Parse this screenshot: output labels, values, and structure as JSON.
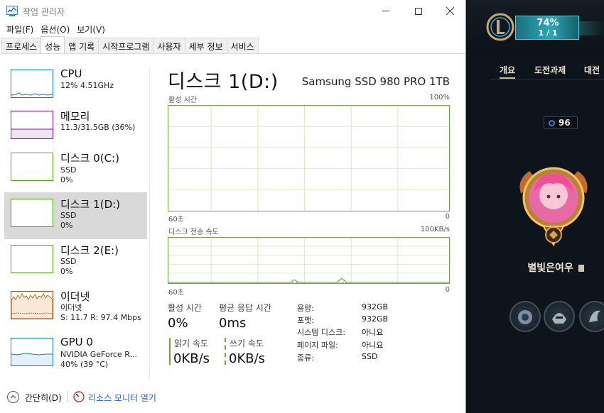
{
  "window": {
    "title": "작업 관리자",
    "controls": {
      "minimize": "—",
      "maximize": "☐",
      "close": "✕"
    }
  },
  "menu": [
    "파일(F)",
    "옵션(O)",
    "보기(V)"
  ],
  "tabs": [
    {
      "label": "프로세스",
      "active": false
    },
    {
      "label": "성능",
      "active": true
    },
    {
      "label": "앱 기록",
      "active": false
    },
    {
      "label": "시작프로그램",
      "active": false
    },
    {
      "label": "사용자",
      "active": false
    },
    {
      "label": "세부 정보",
      "active": false
    },
    {
      "label": "서비스",
      "active": false
    }
  ],
  "sidebar": {
    "items": [
      {
        "title": "CPU",
        "line1": "12% 4.51GHz",
        "line2": "",
        "color": "#117dbb",
        "selected": false
      },
      {
        "title": "메모리",
        "line1": "11.3/31.5GB (36%)",
        "line2": "",
        "color": "#8b12ae",
        "selected": false
      },
      {
        "title": "디스크 0(C:)",
        "line1": "SSD",
        "line2": "0%",
        "color": "#4da60c",
        "selected": false
      },
      {
        "title": "디스크 1(D:)",
        "line1": "SSD",
        "line2": "0%",
        "color": "#4da60c",
        "selected": true
      },
      {
        "title": "디스크 2(E:)",
        "line1": "SSD",
        "line2": "0%",
        "color": "#4da60c",
        "selected": false
      },
      {
        "title": "이더넷",
        "line1": "이더넷",
        "line2": "S: 11.7  R: 97.4 Mbps",
        "color": "#a74f01",
        "selected": false
      },
      {
        "title": "GPU 0",
        "line1": "NVIDIA GeForce R...",
        "line2": "40% (39 °C)",
        "color": "#117dbb",
        "selected": false
      }
    ]
  },
  "detail": {
    "title": "디스크 1(D:)",
    "model": "Samsung SSD 980 PRO 1TB",
    "graph1": {
      "label": "활성 시간",
      "max": "100%",
      "left": "60초",
      "right": "0"
    },
    "graph2": {
      "label": "디스크 전송 속도",
      "max": "100KB/s",
      "left": "60초",
      "right": "0"
    },
    "stats": {
      "active_time_label": "활성 시간",
      "active_time_value": "0%",
      "response_label": "평균 응답 시간",
      "response_value": "0ms",
      "read_label": "읽기 속도",
      "read_value": "0KB/s",
      "write_label": "쓰기 속도",
      "write_value": "0KB/s"
    },
    "properties": [
      {
        "key": "용량:",
        "value": "932GB"
      },
      {
        "key": "포맷:",
        "value": "932GB"
      },
      {
        "key": "시스템 디스크:",
        "value": "아니요"
      },
      {
        "key": "페이지 파일:",
        "value": "아니요"
      },
      {
        "key": "종류:",
        "value": "SSD"
      }
    ],
    "accent": "#4da60c"
  },
  "footer": {
    "less_details": "간단히(D)",
    "resource_monitor": "리소스 모니터 열기"
  },
  "game": {
    "pass_percent": "74%",
    "pass_count": "1 / 1",
    "nav": [
      {
        "label": "개요",
        "active": true
      },
      {
        "label": "도전과제",
        "active": false
      },
      {
        "label": "대전",
        "active": false
      }
    ],
    "level": "96",
    "summoner_name": "별빛은여우",
    "emote_icons": [
      "emote-icon-1",
      "emote-icon-2",
      "emote-icon-3"
    ]
  }
}
